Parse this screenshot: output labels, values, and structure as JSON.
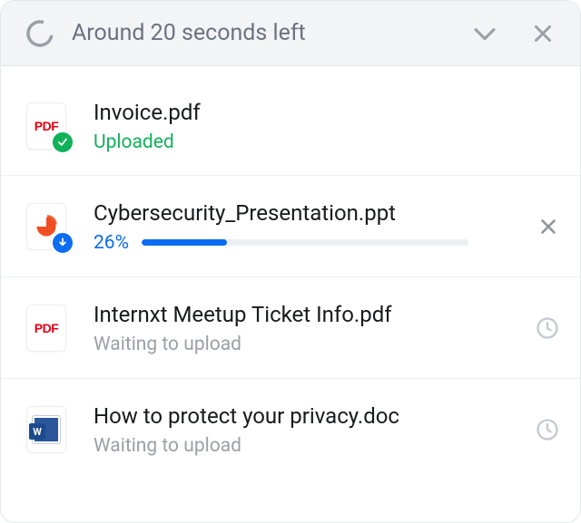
{
  "header": {
    "title": "Around 20 seconds left"
  },
  "files": [
    {
      "name": "Invoice.pdf",
      "status_label": "Uploaded",
      "status": "uploaded"
    },
    {
      "name": "Cybersecurity_Presentation.ppt",
      "status_label": "26%",
      "percent": 26,
      "status": "uploading"
    },
    {
      "name": "Internxt Meetup Ticket Info.pdf",
      "status_label": "Waiting to upload",
      "status": "waiting"
    },
    {
      "name": "How to protect your privacy.doc",
      "status_label": "Waiting to upload",
      "status": "waiting"
    }
  ],
  "colors": {
    "accent_blue": "#0c6cf2",
    "success_green": "#10b259",
    "pdf_red": "#e60012",
    "ppt_orange": "#f04e23"
  }
}
